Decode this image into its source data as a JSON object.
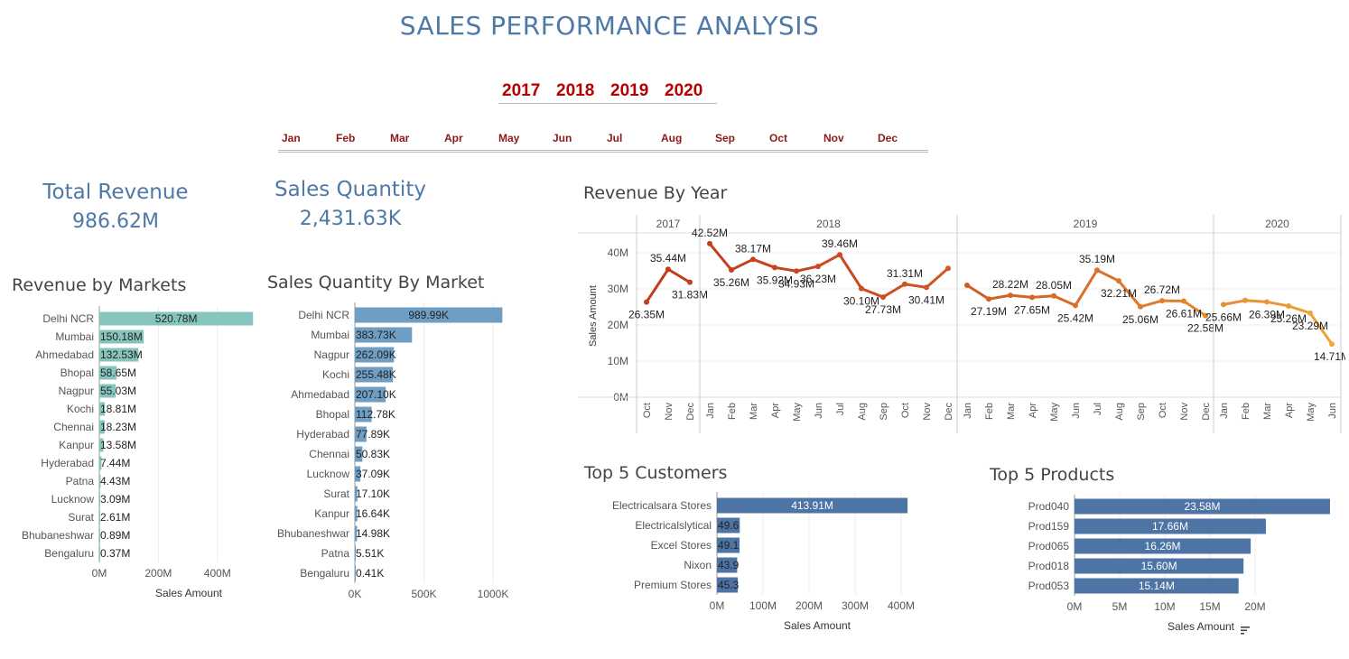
{
  "header": {
    "title": "SALES PERFORMANCE ANALYSIS",
    "years": [
      "2017",
      "2018",
      "2019",
      "2020"
    ],
    "months": [
      "Jan",
      "Feb",
      "Mar",
      "Apr",
      "May",
      "Jun",
      "Jul",
      "Aug",
      "Sep",
      "Oct",
      "Nov",
      "Dec"
    ]
  },
  "kpis": {
    "total_revenue_label": "Total Revenue",
    "total_revenue_value": "986.62M",
    "sales_quantity_label": "Sales Quantity",
    "sales_quantity_value": "2,431.63K"
  },
  "colors": {
    "accent": "#4e79a7",
    "teal": "#86c5bd",
    "steel": "#6f9ec4",
    "navy": "#4e74a6",
    "filter_red": "#b30000"
  },
  "chart_data": [
    {
      "type": "bar",
      "orientation": "horizontal",
      "title": "Revenue by Markets",
      "categories": [
        "Delhi NCR",
        "Mumbai",
        "Ahmedabad",
        "Bhopal",
        "Nagpur",
        "Kochi",
        "Chennai",
        "Kanpur",
        "Hyderabad",
        "Patna",
        "Lucknow",
        "Surat",
        "Bhubaneshwar",
        "Bengaluru"
      ],
      "values": [
        520.78,
        150.18,
        132.53,
        58.65,
        55.03,
        18.81,
        18.23,
        13.58,
        7.44,
        4.43,
        3.09,
        2.61,
        0.89,
        0.37
      ],
      "labels": [
        "520.78M",
        "150.18M",
        "132.53M",
        "58.65M",
        "55.03M",
        "18.81M",
        "18.23M",
        "13.58M",
        "7.44M",
        "4.43M",
        "3.09M",
        "2.61M",
        "0.89M",
        "0.37M"
      ],
      "xlabel": "Sales Amount",
      "xticks": [
        "0M",
        "200M",
        "400M"
      ],
      "xlim": [
        0,
        520
      ],
      "color": "#86c5bd"
    },
    {
      "type": "bar",
      "orientation": "horizontal",
      "title": "Sales Quantity By Market",
      "categories": [
        "Delhi NCR",
        "Mumbai",
        "Nagpur",
        "Kochi",
        "Ahmedabad",
        "Bhopal",
        "Hyderabad",
        "Chennai",
        "Lucknow",
        "Surat",
        "Kanpur",
        "Bhubaneshwar",
        "Patna",
        "Bengaluru"
      ],
      "values": [
        989.99,
        383.73,
        262.09,
        255.48,
        207.1,
        112.78,
        77.89,
        50.83,
        37.09,
        17.1,
        16.64,
        14.98,
        5.51,
        0.41
      ],
      "labels": [
        "989.99K",
        "383.73K",
        "262.09K",
        "255.48K",
        "207.10K",
        "112.78K",
        "77.89K",
        "50.83K",
        "37.09K",
        "17.10K",
        "16.64K",
        "14.98K",
        "5.51K",
        "0.41K"
      ],
      "xlabel": "",
      "xticks": [
        "0K",
        "500K",
        "1000K"
      ],
      "xlim": [
        0,
        1000
      ],
      "color": "#6f9ec4"
    },
    {
      "type": "line",
      "title": "Revenue By Year",
      "ylabel": "Sales Amount",
      "yticks": [
        "0M",
        "10M",
        "20M",
        "30M",
        "40M"
      ],
      "ylim": [
        0,
        45
      ],
      "panels": [
        {
          "year": "2017",
          "months": [
            "Oct",
            "Nov",
            "Dec"
          ],
          "values": [
            26.35,
            35.44,
            31.83
          ],
          "labels": [
            "26.35M",
            "35.44M",
            "31.83M"
          ]
        },
        {
          "year": "2018",
          "months": [
            "Jan",
            "Feb",
            "Mar",
            "Apr",
            "May",
            "Jun",
            "Jul",
            "Aug",
            "Sep",
            "Oct",
            "Nov",
            "Dec"
          ],
          "values": [
            42.52,
            35.26,
            38.17,
            35.92,
            34.93,
            36.23,
            39.46,
            30.1,
            27.73,
            31.31,
            30.41,
            35.7
          ],
          "labels": [
            "42.52M",
            "35.26M",
            "38.17M",
            "35.92M",
            "34.93M",
            "36.23M",
            "39.46M",
            "30.10M",
            "27.73M",
            "31.31M",
            "30.41M",
            ""
          ]
        },
        {
          "year": "2019",
          "months": [
            "Jan",
            "Feb",
            "Mar",
            "Apr",
            "May",
            "Jun",
            "Jul",
            "Aug",
            "Sep",
            "Oct",
            "Nov",
            "Dec"
          ],
          "values": [
            31.0,
            27.19,
            28.22,
            27.65,
            28.05,
            25.42,
            35.19,
            32.21,
            25.06,
            26.72,
            26.61,
            22.58
          ],
          "labels": [
            "",
            "27.19M",
            "28.22M",
            "27.65M",
            "28.05M",
            "25.42M",
            "35.19M",
            "32.21M",
            "25.06M",
            "26.72M",
            "26.61M",
            "22.58M"
          ]
        },
        {
          "year": "2020",
          "months": [
            "Jan",
            "Feb",
            "Mar",
            "Apr",
            "May",
            "Jun"
          ],
          "values": [
            25.66,
            26.8,
            26.39,
            25.26,
            23.29,
            14.71
          ],
          "labels": [
            "25.66M",
            "",
            "26.39M",
            "25.26M",
            "23.29M",
            "14.71M"
          ]
        }
      ],
      "color": "#e0622a"
    },
    {
      "type": "bar",
      "orientation": "horizontal",
      "title": "Top 5 Customers",
      "categories": [
        "Electricalsara Stores",
        "Electricalslytical",
        "Excel Stores",
        "Nixon",
        "Premium Stores"
      ],
      "values": [
        413.91,
        49.6,
        49.1,
        43.9,
        45.3
      ],
      "labels": [
        "413.91M",
        "49.6",
        "49.1",
        "43.9",
        "45.3"
      ],
      "xlabel": "Sales Amount",
      "xticks": [
        "0M",
        "100M",
        "200M",
        "300M",
        "400M"
      ],
      "xlim": [
        0,
        400
      ],
      "color": "#4e74a6"
    },
    {
      "type": "bar",
      "orientation": "horizontal",
      "title": "Top 5 Products",
      "categories": [
        "Prod040",
        "Prod159",
        "Prod065",
        "Prod018",
        "Prod053"
      ],
      "values": [
        23.58,
        17.66,
        16.26,
        15.6,
        15.14
      ],
      "labels": [
        "23.58M",
        "17.66M",
        "16.26M",
        "15.60M",
        "15.14M"
      ],
      "xlabel": "Sales Amount",
      "xticks": [
        "0M",
        "5M",
        "10M",
        "15M",
        "20M"
      ],
      "xlim": [
        0,
        20
      ],
      "color": "#4e74a6"
    }
  ]
}
